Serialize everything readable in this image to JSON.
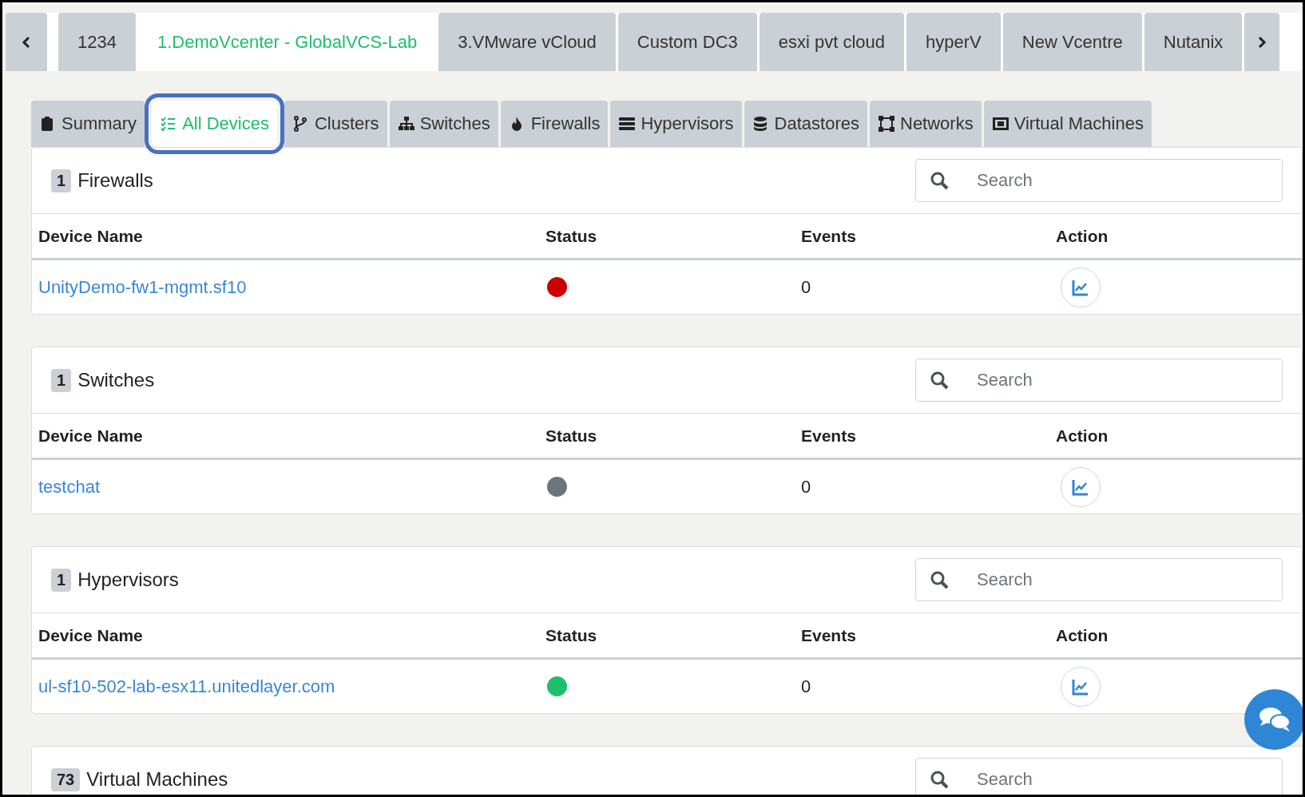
{
  "top_tabs": [
    {
      "label": "1234",
      "selected": false
    },
    {
      "label": "1.DemoVcenter - GlobalVCS-Lab",
      "selected": true
    },
    {
      "label": "3.VMware vCloud",
      "selected": false
    },
    {
      "label": "Custom DC3",
      "selected": false
    },
    {
      "label": "esxi pvt cloud",
      "selected": false
    },
    {
      "label": "hyperV",
      "selected": false
    },
    {
      "label": "New Vcentre",
      "selected": false
    },
    {
      "label": "Nutanix",
      "selected": false
    }
  ],
  "sub_tabs": [
    {
      "label": "Summary",
      "selected": false,
      "highlighted": false
    },
    {
      "label": "All Devices",
      "selected": true,
      "highlighted": true
    },
    {
      "label": "Clusters",
      "selected": false,
      "highlighted": false
    },
    {
      "label": "Switches",
      "selected": false,
      "highlighted": false
    },
    {
      "label": "Firewalls",
      "selected": false,
      "highlighted": false
    },
    {
      "label": "Hypervisors",
      "selected": false,
      "highlighted": false
    },
    {
      "label": "Datastores",
      "selected": false,
      "highlighted": false
    },
    {
      "label": "Networks",
      "selected": false,
      "highlighted": false
    },
    {
      "label": "Virtual Machines",
      "selected": false,
      "highlighted": false
    }
  ],
  "sections": [
    {
      "count": "1",
      "title": "Firewalls",
      "search": {
        "placeholder": "Search"
      },
      "columns": [
        "Device Name",
        "Status",
        "Events",
        "Action"
      ],
      "rows": [
        {
          "name": "UnityDemo-fw1-mgmt.sf10",
          "color": "#cc0000",
          "events": "0"
        }
      ]
    },
    {
      "count": "1",
      "title": "Switches",
      "search": {
        "placeholder": "Search"
      },
      "columns": [
        "Device Name",
        "Status",
        "Events",
        "Action"
      ],
      "rows": [
        {
          "name": "testchat",
          "color": "#6c757d",
          "events": "0"
        }
      ]
    },
    {
      "count": "1",
      "title": "Hypervisors",
      "search": {
        "placeholder": "Search"
      },
      "columns": [
        "Device Name",
        "Status",
        "Events",
        "Action"
      ],
      "rows": [
        {
          "name": "ul-sf10-502-lab-esx11.unitedlayer.com",
          "color": "#1dbf6b",
          "events": "0"
        }
      ]
    },
    {
      "count": "73",
      "title": "Virtual Machines",
      "search": {
        "placeholder": "Search"
      }
    }
  ]
}
